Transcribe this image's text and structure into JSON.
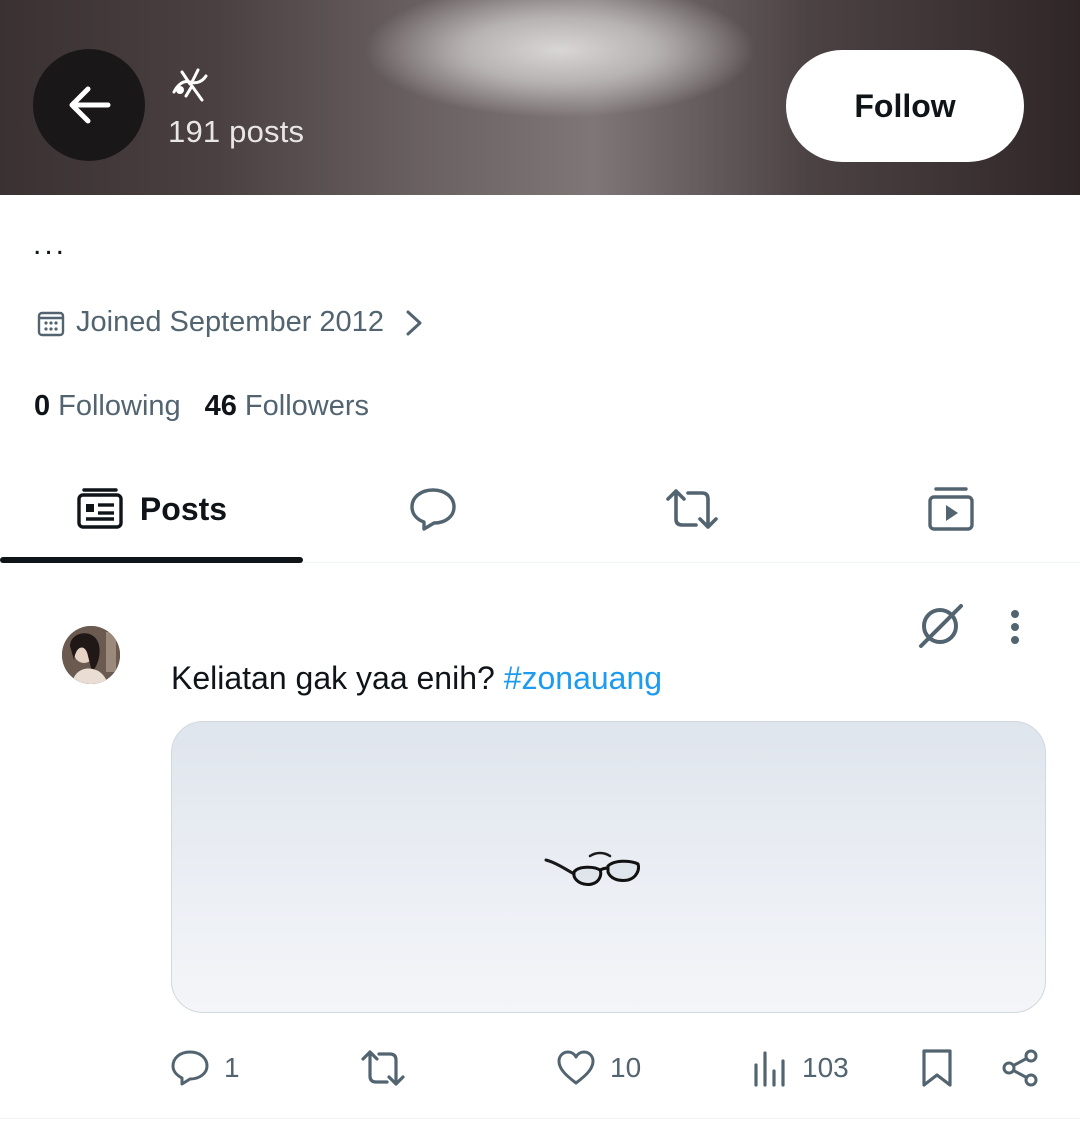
{
  "header": {
    "posts_count": "191 posts",
    "follow_label": "Follow"
  },
  "profile": {
    "bio": "...",
    "joined": "Joined September 2012",
    "following_count": "0",
    "following_label": "Following",
    "followers_count": "46",
    "followers_label": "Followers"
  },
  "tabs": [
    {
      "label": "Posts",
      "icon": "posts-icon",
      "active": true
    },
    {
      "label": "",
      "icon": "reply-icon",
      "active": false
    },
    {
      "label": "",
      "icon": "repost-icon",
      "active": false
    },
    {
      "label": "",
      "icon": "media-icon",
      "active": false
    }
  ],
  "post": {
    "text": "Keliatan gak yaa enih? ",
    "hashtag": "#zonauang",
    "replies": "1",
    "likes": "10",
    "views": "103"
  },
  "colors": {
    "text": "#0f1419",
    "muted": "#536471",
    "link": "#1d9bf0",
    "border": "#cfd9de"
  }
}
